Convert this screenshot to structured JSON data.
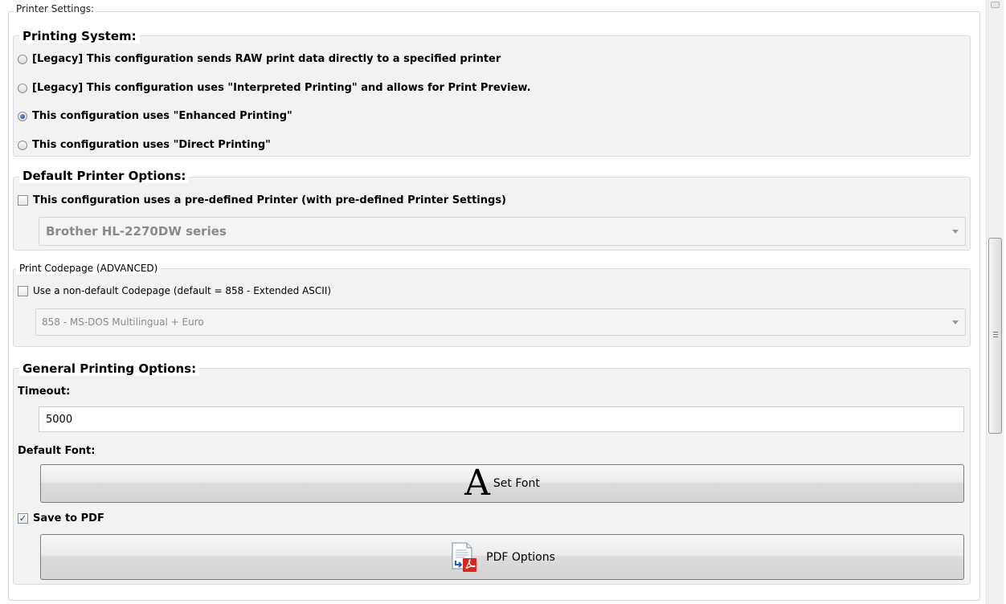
{
  "printer_settings": {
    "title": "Printer Settings:"
  },
  "printing_system": {
    "legend": "Printing System:",
    "options": [
      {
        "label": "[Legacy] This configuration sends RAW print data directly to a specified printer",
        "selected": false
      },
      {
        "label": "[Legacy] This configuration uses \"Interpreted Printing\" and allows for Print Preview.",
        "selected": false
      },
      {
        "label": "This configuration uses \"Enhanced Printing\"",
        "selected": true
      },
      {
        "label": "This configuration uses \"Direct Printing\"",
        "selected": false
      }
    ]
  },
  "default_printer": {
    "legend": "Default Printer Options:",
    "checkbox_label": "This configuration uses a pre-defined Printer (with pre-defined Printer Settings)",
    "checked": false,
    "printer_select_value": "Brother HL-2270DW series"
  },
  "codepage": {
    "legend": "Print Codepage (ADVANCED)",
    "checkbox_label": "Use a non-default Codepage (default = 858 - Extended ASCII)",
    "checked": false,
    "select_value": "858 - MS-DOS Multilingual + Euro"
  },
  "general": {
    "legend": "General Printing Options:",
    "timeout_label": "Timeout:",
    "timeout_value": "5000",
    "default_font_label": "Default Font:",
    "set_font_label": "Set Font",
    "font_icon_glyph": "A",
    "save_pdf_label": "Save to PDF",
    "save_pdf_checked": true,
    "pdf_options_label": "PDF Options"
  },
  "icons": {
    "font": "font-letter-a-icon",
    "pdf": "pdf-document-icon",
    "checkmark": "✓"
  },
  "colors": {
    "accent_radio": "#1a3f80",
    "group_bg": "#f2f2f2",
    "pdf_red": "#d9261c"
  }
}
